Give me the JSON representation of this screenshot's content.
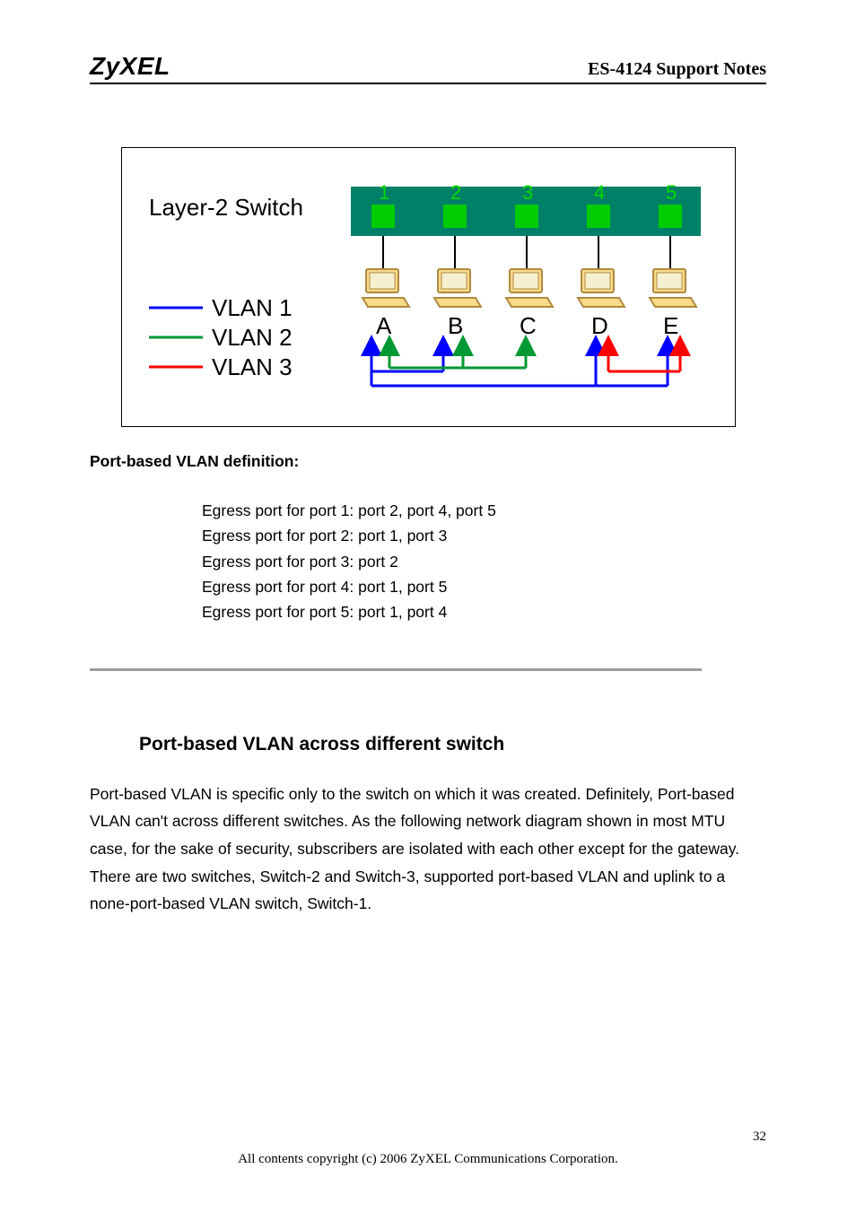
{
  "header": {
    "logo": "ZyXEL",
    "doc_title": "ES-4124 Support Notes"
  },
  "diagram": {
    "switch_label": "Layer-2 Switch",
    "ports": [
      "1",
      "2",
      "3",
      "4",
      "5"
    ],
    "hosts": [
      "A",
      "B",
      "C",
      "D",
      "E"
    ],
    "legend": [
      {
        "label": "VLAN 1",
        "color": "#0000ff"
      },
      {
        "label": "VLAN 2",
        "color": "#009933"
      },
      {
        "label": "VLAN 3",
        "color": "#ff0000"
      }
    ]
  },
  "vlan_def": {
    "title": "Port-based VLAN definition",
    "rules": [
      "Egress port for port 1: port 2, port 4, port 5",
      "Egress port for port 2: port 1, port 3",
      "Egress port for port 3: port 2",
      "Egress port for port 4: port 1, port 5",
      "Egress port for port 5: port 1, port 4"
    ]
  },
  "section": {
    "heading": "Port-based VLAN across different switch",
    "paragraph": "Port-based VLAN is specific only to the switch on which it was created. Definitely, Port-based VLAN can't across different switches. As the following network diagram shown in most MTU case, for the sake of security, subscribers are isolated with each other except for the gateway. There are two switches, Switch-2 and Switch-3, supported port-based VLAN and uplink to a none-port-based VLAN switch, Switch-1."
  },
  "footer": {
    "copyright": "All contents copyright (c) 2006 ZyXEL Communications Corporation.",
    "page": "32"
  }
}
